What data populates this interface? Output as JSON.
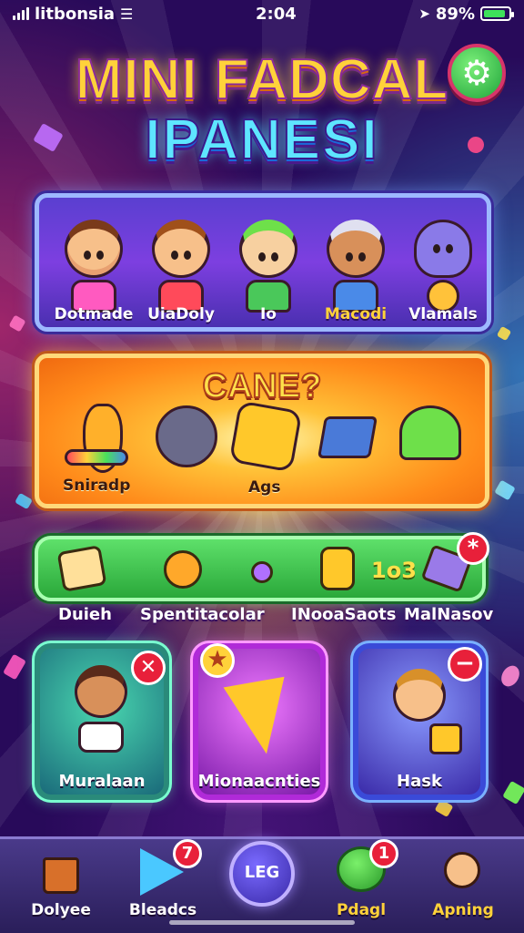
{
  "status_bar": {
    "carrier": "litbonsia",
    "time": "2:04",
    "battery": "89%",
    "battery_level": 0.89
  },
  "title": {
    "line1": "MINI FADCAL",
    "line2": "IPANESI"
  },
  "settings_icon": "gear-icon",
  "characters": [
    {
      "name": "Dotmade"
    },
    {
      "name": "UiaDoly"
    },
    {
      "name": "Io"
    },
    {
      "name": "Macodi"
    },
    {
      "name": "Vlamals"
    }
  ],
  "game_panel": {
    "heading": "CANE?",
    "item_labels": [
      "Sniradp",
      "Ags"
    ]
  },
  "shortcuts": {
    "count": "1o3",
    "labels": [
      "Duieh",
      "Spentitacolar",
      "INooaSaots",
      "MalNasov"
    ],
    "badge_symbol": "*"
  },
  "cards": [
    {
      "label": "Muralaan",
      "badge": "✕"
    },
    {
      "label": "Mionaacnties",
      "badge": "★"
    },
    {
      "label": "Hask",
      "badge": "−"
    }
  ],
  "bottom_nav": {
    "items": [
      {
        "label": "Dolyee",
        "icon": "house-icon"
      },
      {
        "label": "Bleadcs",
        "icon": "triangle-icon",
        "badge": "7"
      },
      {
        "label": "",
        "icon": "center-orb-icon",
        "center_text": "LEG"
      },
      {
        "label": "Pdagl",
        "icon": "chat-bubble-icon",
        "badge": "1"
      },
      {
        "label": "Apning",
        "icon": "profile-icon"
      }
    ]
  },
  "colors": {
    "title_yellow": "#ffd23a",
    "title_cyan": "#5ee6ff",
    "badge_red": "#e8203a",
    "green_bar": "#2aa83a"
  }
}
